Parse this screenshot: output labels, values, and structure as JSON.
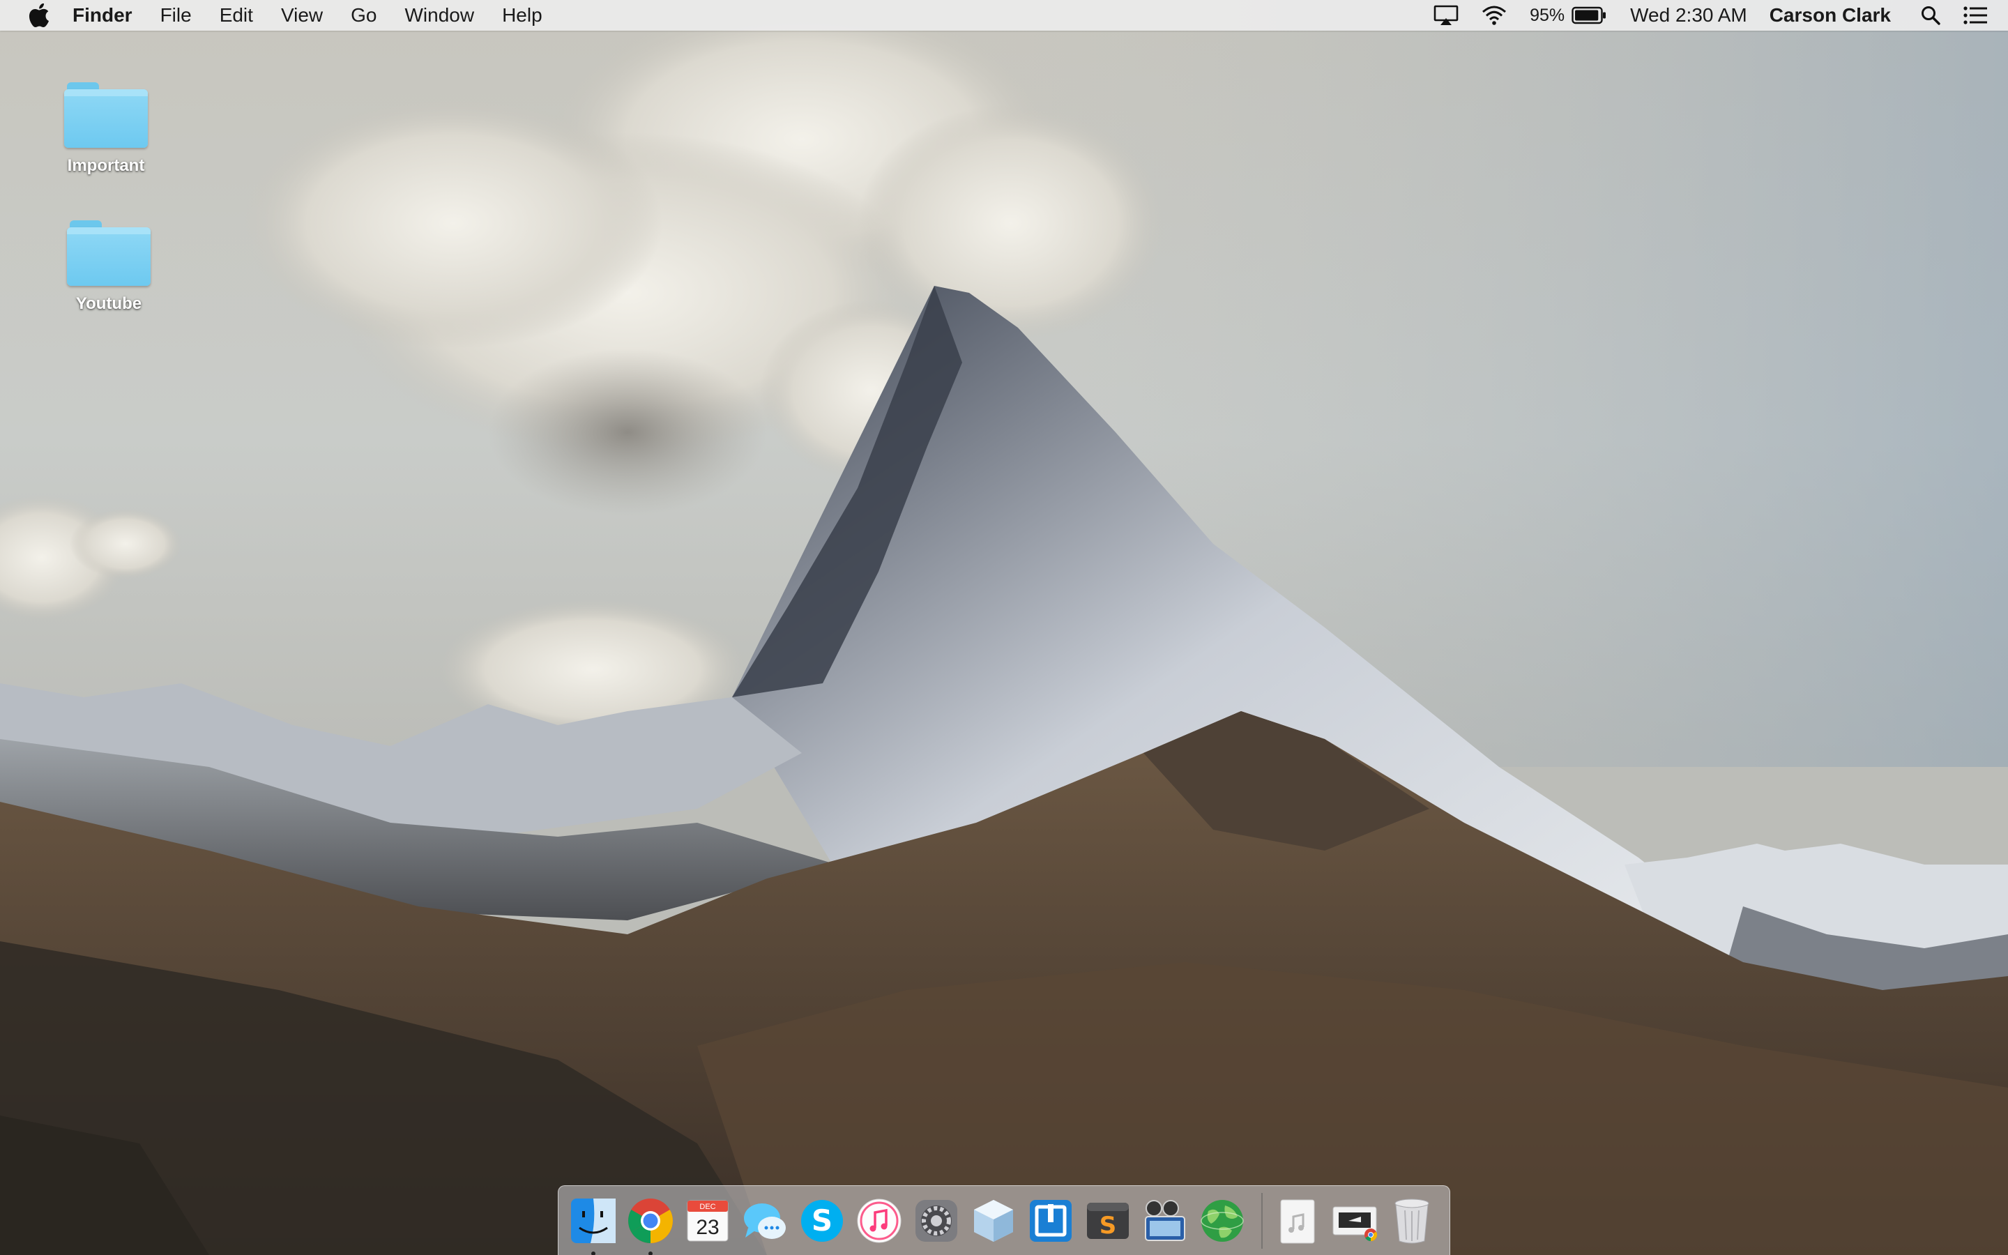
{
  "menubar": {
    "apple_icon": "apple-logo-icon",
    "app_name": "Finder",
    "menus": [
      "File",
      "Edit",
      "View",
      "Go",
      "Window",
      "Help"
    ],
    "status": {
      "airplay_icon": "airplay-icon",
      "wifi_icon": "wifi-icon",
      "battery_percent": "95%",
      "battery_level": 0.95,
      "battery_icon": "battery-icon",
      "datetime": "Wed 2:30 AM",
      "user": "Carson Clark",
      "spotlight_icon": "search-icon",
      "notification_icon": "notification-center-icon"
    }
  },
  "desktop": {
    "icons": [
      {
        "label": "Important",
        "icon": "folder-icon"
      },
      {
        "label": "Youtube",
        "icon": "folder-icon"
      }
    ]
  },
  "dock": {
    "apps": [
      {
        "name": "Finder",
        "icon": "finder-icon",
        "running": true
      },
      {
        "name": "Google Chrome",
        "icon": "chrome-icon",
        "running": true
      },
      {
        "name": "Calendar",
        "icon": "calendar-icon",
        "month": "DEC",
        "day": "23",
        "running": false
      },
      {
        "name": "Messages",
        "icon": "messages-icon",
        "running": false
      },
      {
        "name": "Skype",
        "icon": "skype-icon",
        "glyph": "S",
        "running": false
      },
      {
        "name": "iTunes",
        "icon": "itunes-icon",
        "running": false
      },
      {
        "name": "System Preferences",
        "icon": "system-preferences-icon",
        "running": false
      },
      {
        "name": "Cube App",
        "icon": "cube-icon",
        "running": false
      },
      {
        "name": "Window App",
        "icon": "window-app-icon",
        "running": false
      },
      {
        "name": "Sublime Text",
        "icon": "sublime-text-icon",
        "glyph": "S",
        "running": false
      },
      {
        "name": "Photo Booth",
        "icon": "photo-booth-icon",
        "running": false
      },
      {
        "name": "Globe App",
        "icon": "globe-icon",
        "running": false
      }
    ],
    "stacks": [
      {
        "name": "Music Stack",
        "icon": "music-file-icon"
      },
      {
        "name": "Chrome Apps Stack",
        "icon": "chrome-apps-icon"
      },
      {
        "name": "Trash",
        "icon": "trash-icon"
      }
    ]
  },
  "colors": {
    "menubar_bg": "#ececec",
    "folder_blue": "#6dc9f0",
    "chrome_red": "#db4437",
    "chrome_green": "#0f9d58",
    "chrome_yellow": "#f4b400",
    "chrome_blue": "#4285f4",
    "skype_blue": "#00aff0"
  }
}
